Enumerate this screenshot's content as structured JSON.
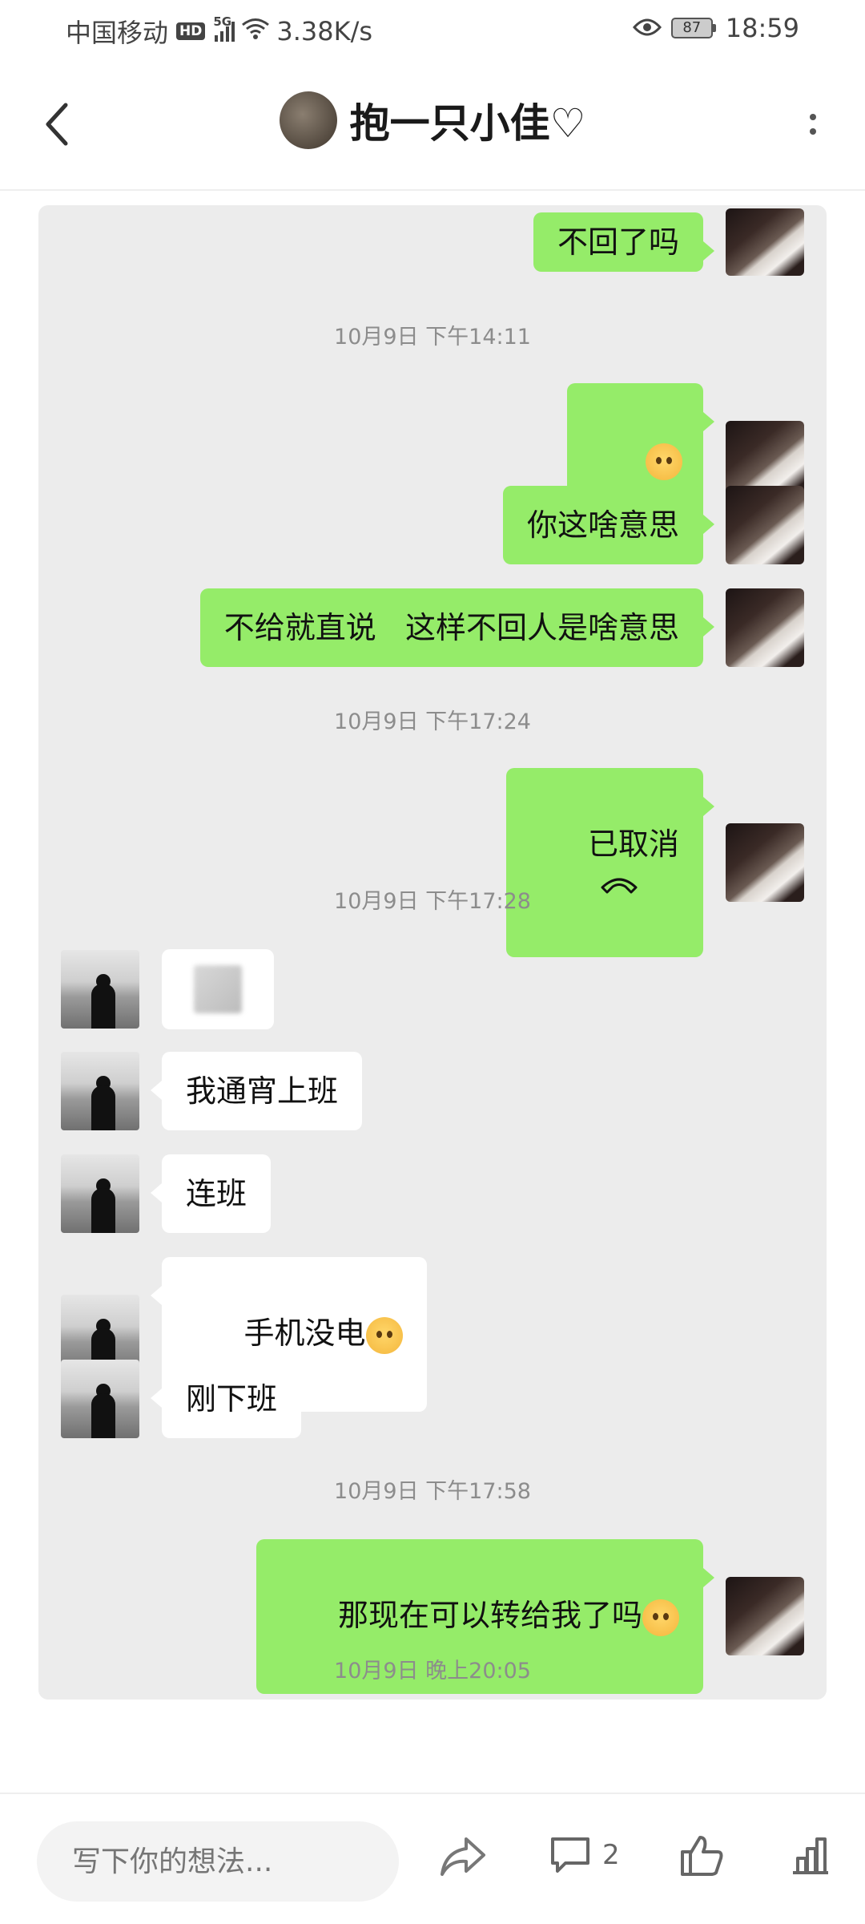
{
  "status_bar": {
    "carrier": "中国移动",
    "hd": "HD",
    "network": "5G",
    "speed": "3.38K/s",
    "battery": "87",
    "time": "18:59"
  },
  "nav": {
    "title": "抱一只小佳♡"
  },
  "chat": {
    "msg_top": "不回了吗",
    "ts1": "10月9日 下午14:11",
    "msg_q_emoji": "",
    "msg_what_mean": "你这啥意思",
    "msg_no_give": "不给就直说   这样不回人是啥意思",
    "ts2": "10月9日 下午17:24",
    "msg_cancelled": "已取消",
    "ts3": "10月9日 下午17:28",
    "msg_night_shift": "我通宵上班",
    "msg_double_shift": "连班",
    "msg_no_battery": "手机没电",
    "msg_just_off": "刚下班",
    "ts4": "10月9日 下午17:58",
    "msg_transfer": "那现在可以转给我了吗",
    "ts5": "10月9日 晚上20:05"
  },
  "bottom": {
    "placeholder": "写下你的想法...",
    "comment_count": "2"
  },
  "colors": {
    "green_bubble": "#95ec69",
    "card_bg": "#ececec"
  }
}
